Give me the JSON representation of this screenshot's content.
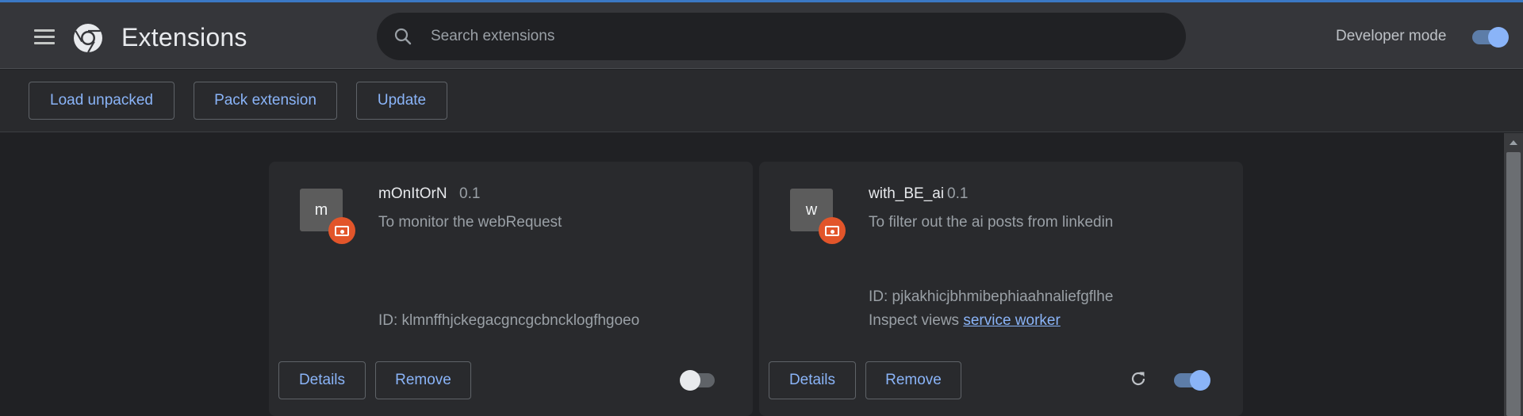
{
  "header": {
    "title": "Extensions",
    "search_placeholder": "Search extensions",
    "developer_mode_label": "Developer mode",
    "developer_mode_on": true
  },
  "toolbar": {
    "load_unpacked": "Load unpacked",
    "pack_extension": "Pack extension",
    "update": "Update"
  },
  "extensions": [
    {
      "letter": "m",
      "name": "mOnItOrN",
      "version": "0.1",
      "description": "To monitor the webRequest",
      "id_text": "ID: klmnffhjckegacgncgcbncklogfhgoeo",
      "enabled": false,
      "details": "Details",
      "remove": "Remove"
    },
    {
      "letter": "w",
      "name": "with_BE_ai",
      "version": "0.1",
      "description": "To filter out the ai posts from linkedin",
      "id_text": "ID: pjkakhicjbhmibephiaahnaliefgflhe",
      "inspect_label": "Inspect views",
      "inspect_link": "service worker",
      "enabled": true,
      "details": "Details",
      "remove": "Remove"
    }
  ],
  "colors": {
    "accent": "#8ab4f8",
    "header_bg": "#35363a",
    "page_bg": "#202124",
    "card_bg": "#292a2d",
    "badge": "#e2552a"
  },
  "icons": [
    "menu-icon",
    "chrome-logo",
    "search-icon",
    "extension-error-badge-icon",
    "reload-icon"
  ]
}
